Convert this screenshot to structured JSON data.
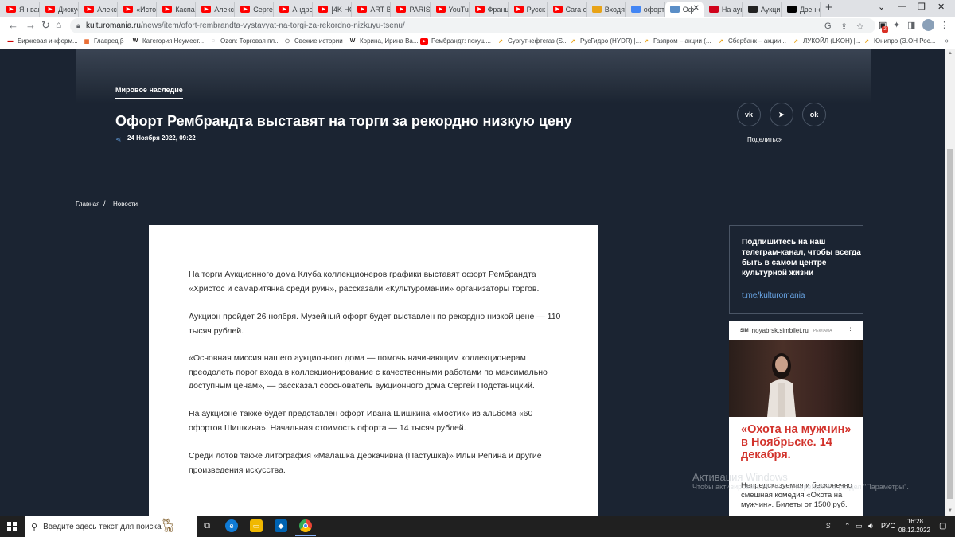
{
  "browser": {
    "tabs": [
      {
        "label": "Ян ван",
        "icon": "youtube-icon",
        "color": "#ff0000"
      },
      {
        "label": "Дискус",
        "icon": "youtube-icon",
        "color": "#ff0000"
      },
      {
        "label": "Алексе",
        "icon": "youtube-icon",
        "color": "#ff0000"
      },
      {
        "label": "«Истор",
        "icon": "youtube-icon",
        "color": "#ff0000"
      },
      {
        "label": "Каспар",
        "icon": "youtube-icon",
        "color": "#ff0000"
      },
      {
        "label": "Алексе",
        "icon": "youtube-icon",
        "color": "#ff0000"
      },
      {
        "label": "Сергеi",
        "icon": "youtube-icon",
        "color": "#ff0000"
      },
      {
        "label": "Андре",
        "icon": "youtube-icon",
        "color": "#ff0000"
      },
      {
        "label": "[4K HC",
        "icon": "youtube-icon",
        "color": "#ff0000"
      },
      {
        "label": "ART BA",
        "icon": "youtube-icon",
        "color": "#ff0000"
      },
      {
        "label": "PARIS-",
        "icon": "youtube-icon",
        "color": "#ff0000"
      },
      {
        "label": "YouTul",
        "icon": "youtube-icon",
        "color": "#ff0000"
      },
      {
        "label": "Франц",
        "icon": "youtube-icon",
        "color": "#ff0000"
      },
      {
        "label": "Русск",
        "icon": "youtube-icon",
        "color": "#ff0000"
      },
      {
        "label": "Cara o",
        "icon": "youtube-icon",
        "color": "#ff0000"
      },
      {
        "label": "Входя",
        "icon": "mail-icon",
        "color": "#e8a317"
      },
      {
        "label": "офорт",
        "icon": "google-icon",
        "color": "#4285f4"
      },
      {
        "label": "Оф",
        "icon": "kulturomania-icon",
        "color": "#5a8ec7",
        "active": true
      },
      {
        "label": "На аук",
        "icon": "red-square-icon",
        "color": "#d0021b"
      },
      {
        "label": "Аукци",
        "icon": "dark-square-icon",
        "color": "#222222"
      },
      {
        "label": "Дзен-с",
        "icon": "dzen-icon",
        "color": "#000000"
      }
    ],
    "url_host": "kulturomania.ru",
    "url_path": "/news/item/ofort-rembrandta-vystavyat-na-torgi-za-rekordno-nizkuyu-tsenu/",
    "extension_badge": "2",
    "bookmarks": [
      {
        "label": "Биржевая информ...",
        "icon": "flag-icon",
        "color": "#cc0000"
      },
      {
        "label": "Главред β",
        "icon": "glavred-icon",
        "color": "#e85d1e"
      },
      {
        "label": "Категория:Неумест...",
        "icon": "wikipedia-icon",
        "color": "#222222"
      },
      {
        "label": "Ozon: Торговая пл...",
        "icon": "globe-icon",
        "color": "#5f6368"
      },
      {
        "label": "Свежие истории",
        "icon": "people-icon",
        "color": "#555555"
      },
      {
        "label": "Корина, Ирина Ва...",
        "icon": "wikipedia-icon",
        "color": "#222222"
      },
      {
        "label": "Рембрандт: покуш...",
        "icon": "youtube-icon",
        "color": "#ff0000"
      },
      {
        "label": "Сургутнефтегаз (S...",
        "icon": "chart-icon",
        "color": "#e8a317"
      },
      {
        "label": "РусГидро (HYDR) |...",
        "icon": "chart-icon",
        "color": "#e8a317"
      },
      {
        "label": "Газпром – акции (...",
        "icon": "chart-icon",
        "color": "#e8a317"
      },
      {
        "label": "Сбербанк – акции...",
        "icon": "chart-icon",
        "color": "#e8a317"
      },
      {
        "label": "ЛУКОЙЛ (LKOH) |...",
        "icon": "chart-icon",
        "color": "#e8a317"
      },
      {
        "label": "Юнипро (Э.ОН Рос...",
        "icon": "chart-icon",
        "color": "#e8a317"
      }
    ]
  },
  "article": {
    "category": "Мировое наследие",
    "title": "Офорт Рембрандта выставят на торги за рекордно низкую цену",
    "date": "24 Ноября 2022, 09:22",
    "share_label": "Поделиться",
    "share_buttons": [
      "vk",
      "telegram",
      "odnoklassniki"
    ],
    "breadcrumb": [
      "Главная",
      "Новости"
    ],
    "paragraphs": [
      "На торги Аукционного дома Клуба коллекционеров графики выставят офорт Рембрандта «Христос и самаритянка среди руин», рассказали «Культуромании» организаторы торгов.",
      "Аукцион пройдет 26 ноября. Музейный офорт будет выставлен по рекордно низкой цене — 110 тысяч рублей.",
      "«Основная миссия нашего аукционного дома — помочь начинающим коллекционерам преодолеть порог входа в коллекционирование с качественными работами по максимально доступным ценам», — рассказал сооснователь аукционного дома Сергей Подстаницкий.",
      "На аукционе также будет представлен офорт Ивана Шишкина «Мостик» из альбома «60 офортов Шишкина». Начальная стоимость офорта — 14 тысяч рублей.",
      "Среди лотов также литография «Малашка Деркачивна (Пастушка)» Ильи Репина и другие произведения искусства."
    ]
  },
  "sidebar": {
    "telegram_text": "Подпишитесь на наш телеграм-канал, чтобы всегда быть в самом центре культурной жизни",
    "telegram_link": "t.me/kulturomania",
    "ad": {
      "logo": "SIM",
      "domain": "noyabrsk.simbilet.ru",
      "label": "РЕКЛАМА",
      "headline": "«Охота на мужчин» в Ноябрьске. 14 декабря.",
      "body": "Непредсказуемая и бесконечно смешная комедия «Охота на мужчин». Билеты от 1500 руб."
    }
  },
  "watermark": {
    "line1": "Активация Windows",
    "line2": "Чтобы активировать Windows, перейдите в раздел \"Параметры\"."
  },
  "taskbar": {
    "search_placeholder": "Введите здесь текст для поиска",
    "language": "РУС",
    "time": "16:28",
    "date": "08.12.2022"
  }
}
